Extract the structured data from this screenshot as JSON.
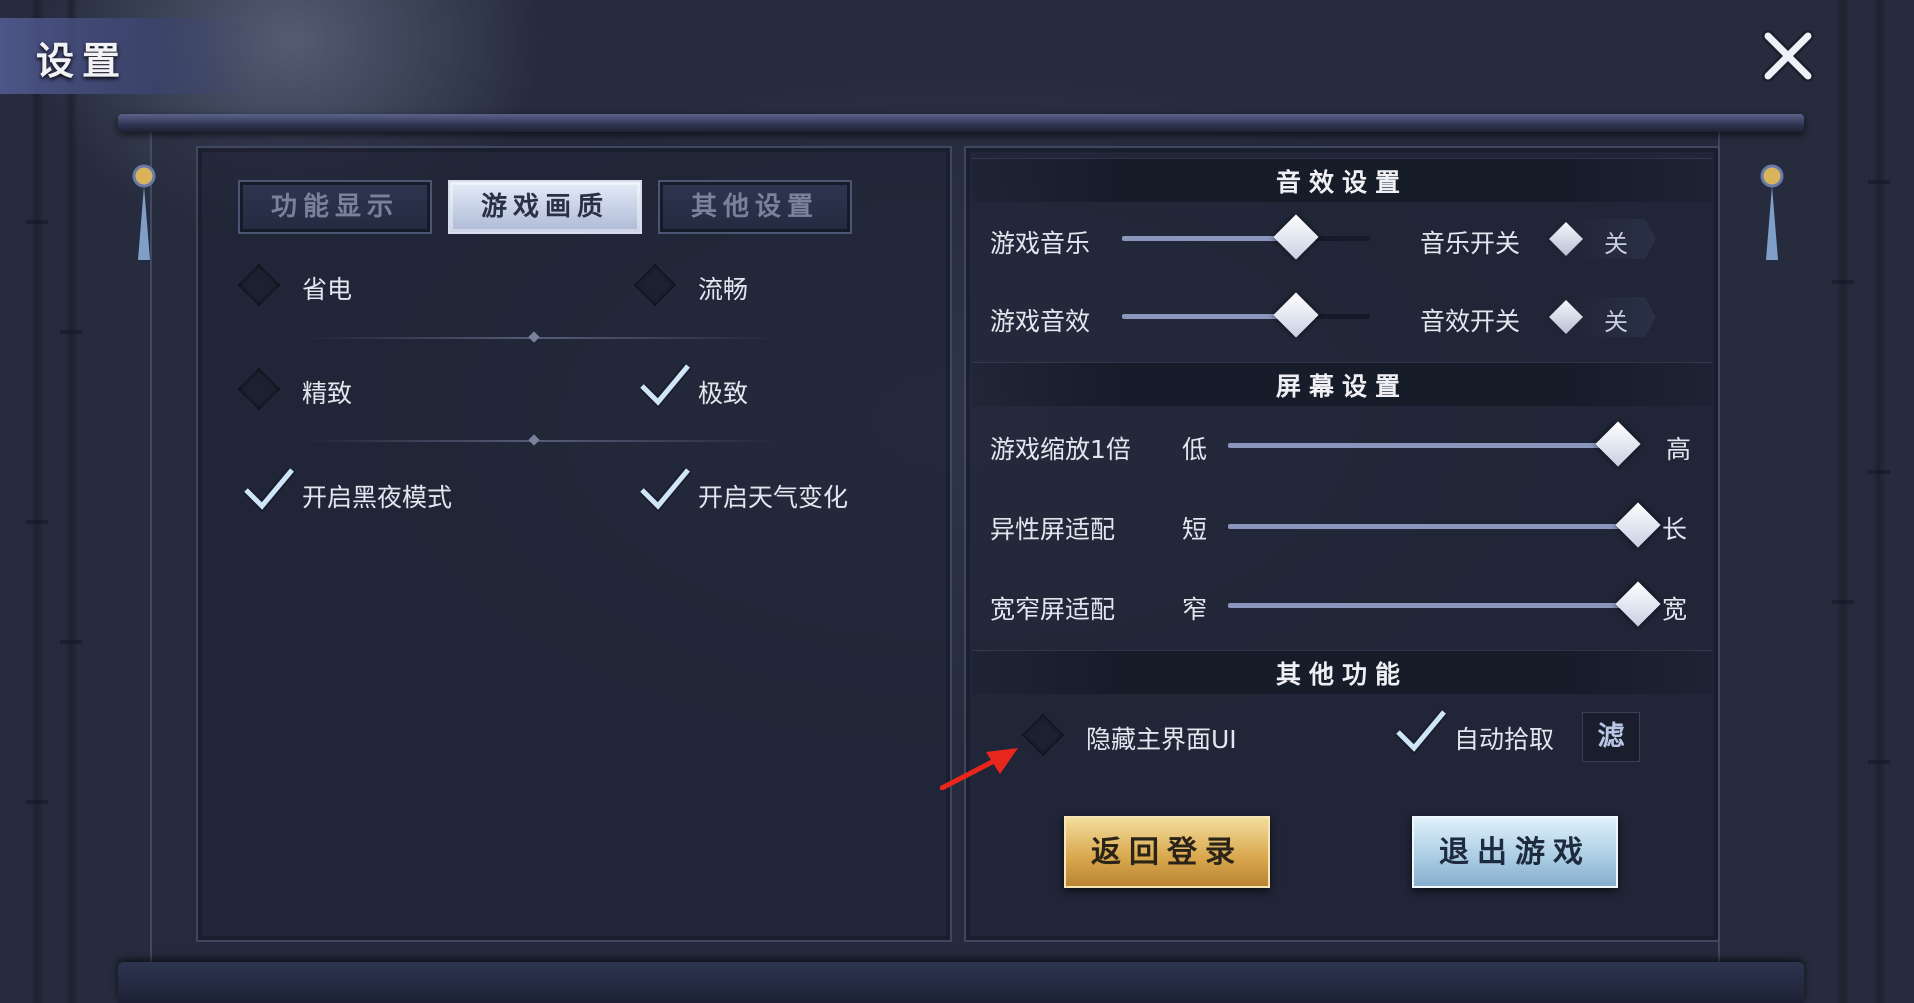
{
  "header": {
    "title": "设置"
  },
  "tabs": [
    {
      "label": "功能显示",
      "active": false
    },
    {
      "label": "游戏画质",
      "active": true
    },
    {
      "label": "其他设置",
      "active": false
    }
  ],
  "graphics": {
    "quality_options": [
      {
        "label": "省电",
        "checked": false
      },
      {
        "label": "流畅",
        "checked": false
      },
      {
        "label": "精致",
        "checked": false
      },
      {
        "label": "极致",
        "checked": true
      }
    ],
    "toggles": [
      {
        "label": "开启黑夜模式",
        "checked": true
      },
      {
        "label": "开启天气变化",
        "checked": true
      }
    ]
  },
  "sound": {
    "section_title": "音效设置",
    "rows": [
      {
        "label": "游戏音乐",
        "value": 0.7,
        "switch_label": "音乐开关",
        "switch_state": "关"
      },
      {
        "label": "游戏音效",
        "value": 0.7,
        "switch_label": "音效开关",
        "switch_state": "关"
      }
    ]
  },
  "screen": {
    "section_title": "屏幕设置",
    "rows": [
      {
        "label": "游戏缩放1倍",
        "min_label": "低",
        "max_label": "高",
        "value": 0.95
      },
      {
        "label": "异性屏适配",
        "min_label": "短",
        "max_label": "长",
        "value": 1.0
      },
      {
        "label": "宽窄屏适配",
        "min_label": "窄",
        "max_label": "宽",
        "value": 1.0
      }
    ]
  },
  "other": {
    "section_title": "其他功能",
    "hide_ui": {
      "label": "隐藏主界面UI",
      "checked": false
    },
    "auto_pickup": {
      "label": "自动拾取",
      "checked": true
    },
    "filter_label": "滤"
  },
  "buttons": {
    "return_login": "返回登录",
    "exit_game": "退出游戏"
  },
  "colors": {
    "accent_gold": "#d8a64c",
    "accent_blue": "#a9cbe3",
    "annotation_red": "#e8261c"
  }
}
